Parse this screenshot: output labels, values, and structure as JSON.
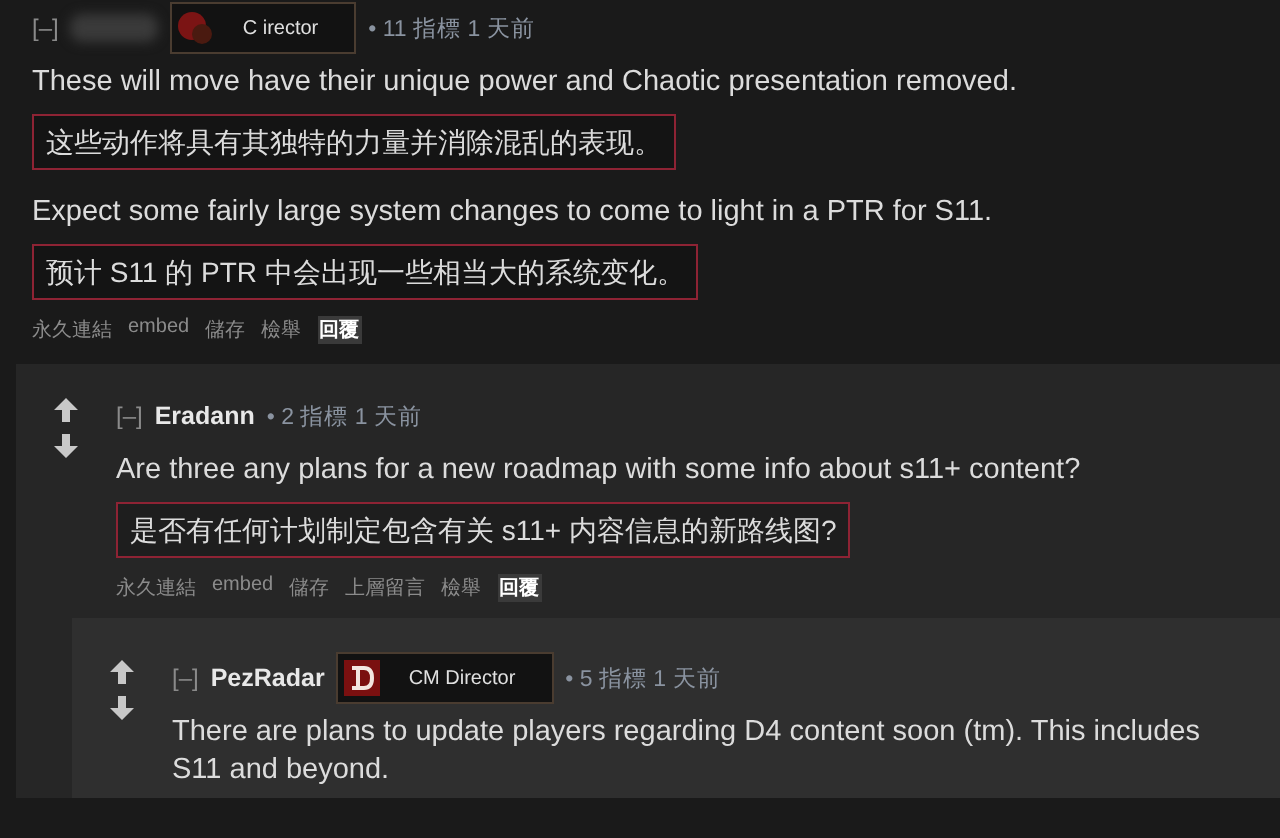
{
  "comments": [
    {
      "collapse": "[–]",
      "flair": {
        "text": "C    irector"
      },
      "meta": "• 11 指標 1 天前",
      "body": [
        {
          "kind": "text",
          "text": "These will move have their unique power and Chaotic presentation removed."
        },
        {
          "kind": "translation",
          "text": "这些动作将具有其独特的力量并消除混乱的表现。"
        },
        {
          "kind": "text",
          "text": "Expect some fairly large system changes to come to light in a PTR for S11."
        },
        {
          "kind": "translation",
          "text": "预计 S11 的 PTR 中会出现一些相当大的系统变化。"
        }
      ],
      "actions": [
        {
          "label": "永久連結",
          "selected": false
        },
        {
          "label": "embed",
          "selected": false
        },
        {
          "label": "儲存",
          "selected": false
        },
        {
          "label": "檢舉",
          "selected": false
        },
        {
          "label": "回覆",
          "selected": true
        }
      ],
      "children": [
        {
          "collapse": "[–]",
          "author": "Eradann",
          "meta": "• 2 指標 1 天前",
          "body": [
            {
              "kind": "text",
              "text": "Are three any plans for a new roadmap with some info about s11+ content?"
            },
            {
              "kind": "translation",
              "text": "是否有任何计划制定包含有关 s11+ 内容信息的新路线图?"
            }
          ],
          "actions": [
            {
              "label": "永久連結",
              "selected": false
            },
            {
              "label": "embed",
              "selected": false
            },
            {
              "label": "儲存",
              "selected": false
            },
            {
              "label": "上層留言",
              "selected": false
            },
            {
              "label": "檢舉",
              "selected": false
            },
            {
              "label": "回覆",
              "selected": true
            }
          ],
          "children": [
            {
              "collapse": "[–]",
              "author": "PezRadar",
              "flair": {
                "text": "CM Director"
              },
              "meta": "• 5 指標 1 天前",
              "body": [
                {
                  "kind": "text",
                  "text": "There are plans to update players regarding D4 content soon (tm). This includes S11 and beyond."
                }
              ]
            }
          ]
        }
      ]
    }
  ]
}
